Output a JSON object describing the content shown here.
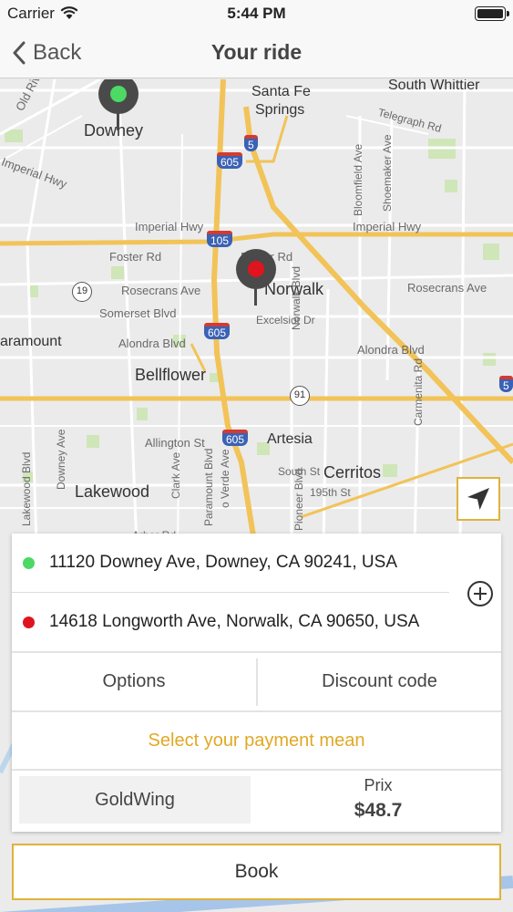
{
  "status_bar": {
    "carrier": "Carrier",
    "time": "5:44 PM"
  },
  "nav": {
    "back_label": "Back",
    "title": "Your ride"
  },
  "map": {
    "cities": [
      "Downey",
      "Norwalk",
      "Bellflower",
      "Artesia",
      "Cerritos",
      "Lakewood",
      "aramount",
      "Santa Fe",
      "Springs",
      "South Whittier"
    ],
    "streets": [
      "Old River School Rd",
      "Imperial Hwy",
      "Imperial Hwy",
      "Imperial Hwy",
      "Foster Rd",
      "Foster Rd",
      "Rosecrans Ave",
      "Rosecrans Ave",
      "Somerset Blvd",
      "Alondra Blvd",
      "Alondra Blvd",
      "Excelsior Dr",
      "Norwalk Blvd",
      "Allington St",
      "South St",
      "195th St",
      "Downey Ave",
      "Bloomfield Ave",
      "Shoemaker Ave",
      "Telegraph Rd",
      "Carmenita Rd",
      "Paramount Blvd",
      "Lakewood Blvd",
      "Pioneer Blvd",
      "Clark Ave",
      "Arbor Rd",
      "o Verde Ave"
    ],
    "highways": [
      "605",
      "5",
      "105",
      "605",
      "605",
      "5"
    ],
    "state_routes": [
      "19",
      "91"
    ]
  },
  "ride": {
    "pickup": "11120 Downey Ave, Downey, CA 90241, USA",
    "dropoff": "14618 Longworth Ave, Norwalk, CA 90650, USA",
    "options_label": "Options",
    "discount_label": "Discount code",
    "payment_label": "Select your payment mean",
    "vehicle": "GoldWing",
    "price_label": "Prix",
    "price": "$48.7"
  },
  "book_label": "Book",
  "colors": {
    "accent": "#e1b23b",
    "pickup_dot": "#4cd964",
    "dropoff_dot": "#e0141e",
    "payment_text": "#e1a825"
  },
  "icons": [
    "wifi-icon",
    "battery-icon",
    "back-chevron-icon",
    "map-pin-icon",
    "location-arrow-icon",
    "add-circle-icon"
  ]
}
